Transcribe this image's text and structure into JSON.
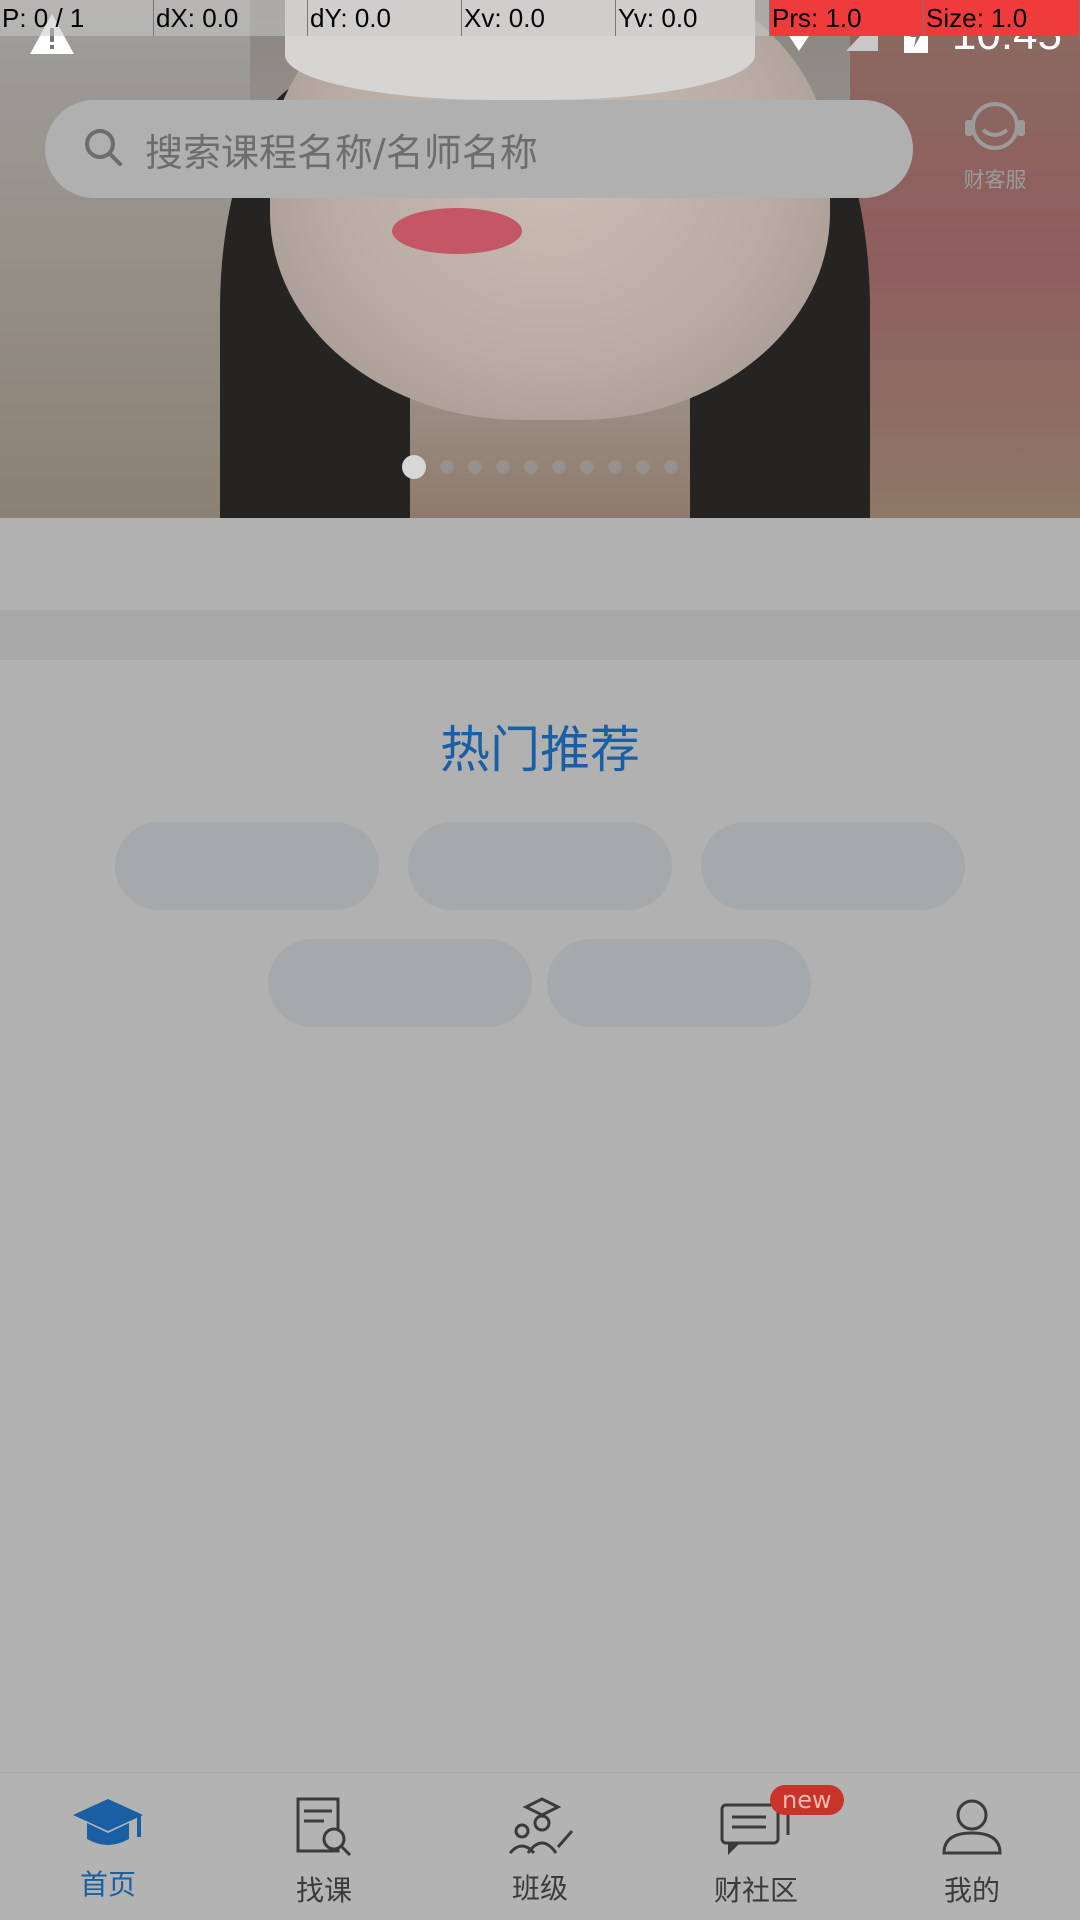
{
  "debug_overlay": {
    "pointer": "P: 0 / 1",
    "dx": "dX: 0.0",
    "dy": "dY: 0.0",
    "xv": "Xv: 0.0",
    "yv": "Yv: 0.0",
    "prs": "Prs: 1.0",
    "size": "Size: 1.0"
  },
  "status_bar": {
    "time": "10:45"
  },
  "search": {
    "placeholder": "搜索课程名称/名师名称"
  },
  "customer_service": {
    "label": "财客服"
  },
  "carousel": {
    "count": 10,
    "active_index": 0
  },
  "hot_section": {
    "title": "热门推荐"
  },
  "bottom_nav": [
    {
      "label": "首页",
      "icon": "graduation-cap-icon",
      "active": true
    },
    {
      "label": "找课",
      "icon": "find-course-icon",
      "active": false
    },
    {
      "label": "班级",
      "icon": "class-icon",
      "active": false
    },
    {
      "label": "财社区",
      "icon": "chat-icon",
      "active": false,
      "badge": "new"
    },
    {
      "label": "我的",
      "icon": "user-icon",
      "active": false
    }
  ],
  "colors": {
    "accent": "#1a5fa3",
    "badge": "#c9342a"
  }
}
